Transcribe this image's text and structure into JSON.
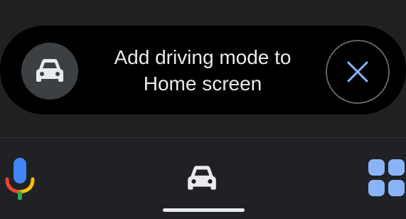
{
  "banner": {
    "text": "Add driving mode to Home screen",
    "car_icon": "car-icon",
    "close_icon": "close-icon"
  },
  "bottom_bar": {
    "mic_icon": "microphone-icon",
    "car_icon": "car-icon",
    "apps_icon": "apps-grid-icon"
  },
  "colors": {
    "background": "#202124",
    "banner_bg": "#000000",
    "badge_bg": "#3c4043",
    "accent_blue": "#8ab4f8",
    "text": "#e8eaed",
    "mic_red": "#ea4335",
    "mic_yellow": "#fbbc04",
    "mic_green": "#34a853",
    "mic_blue": "#4285f4"
  }
}
